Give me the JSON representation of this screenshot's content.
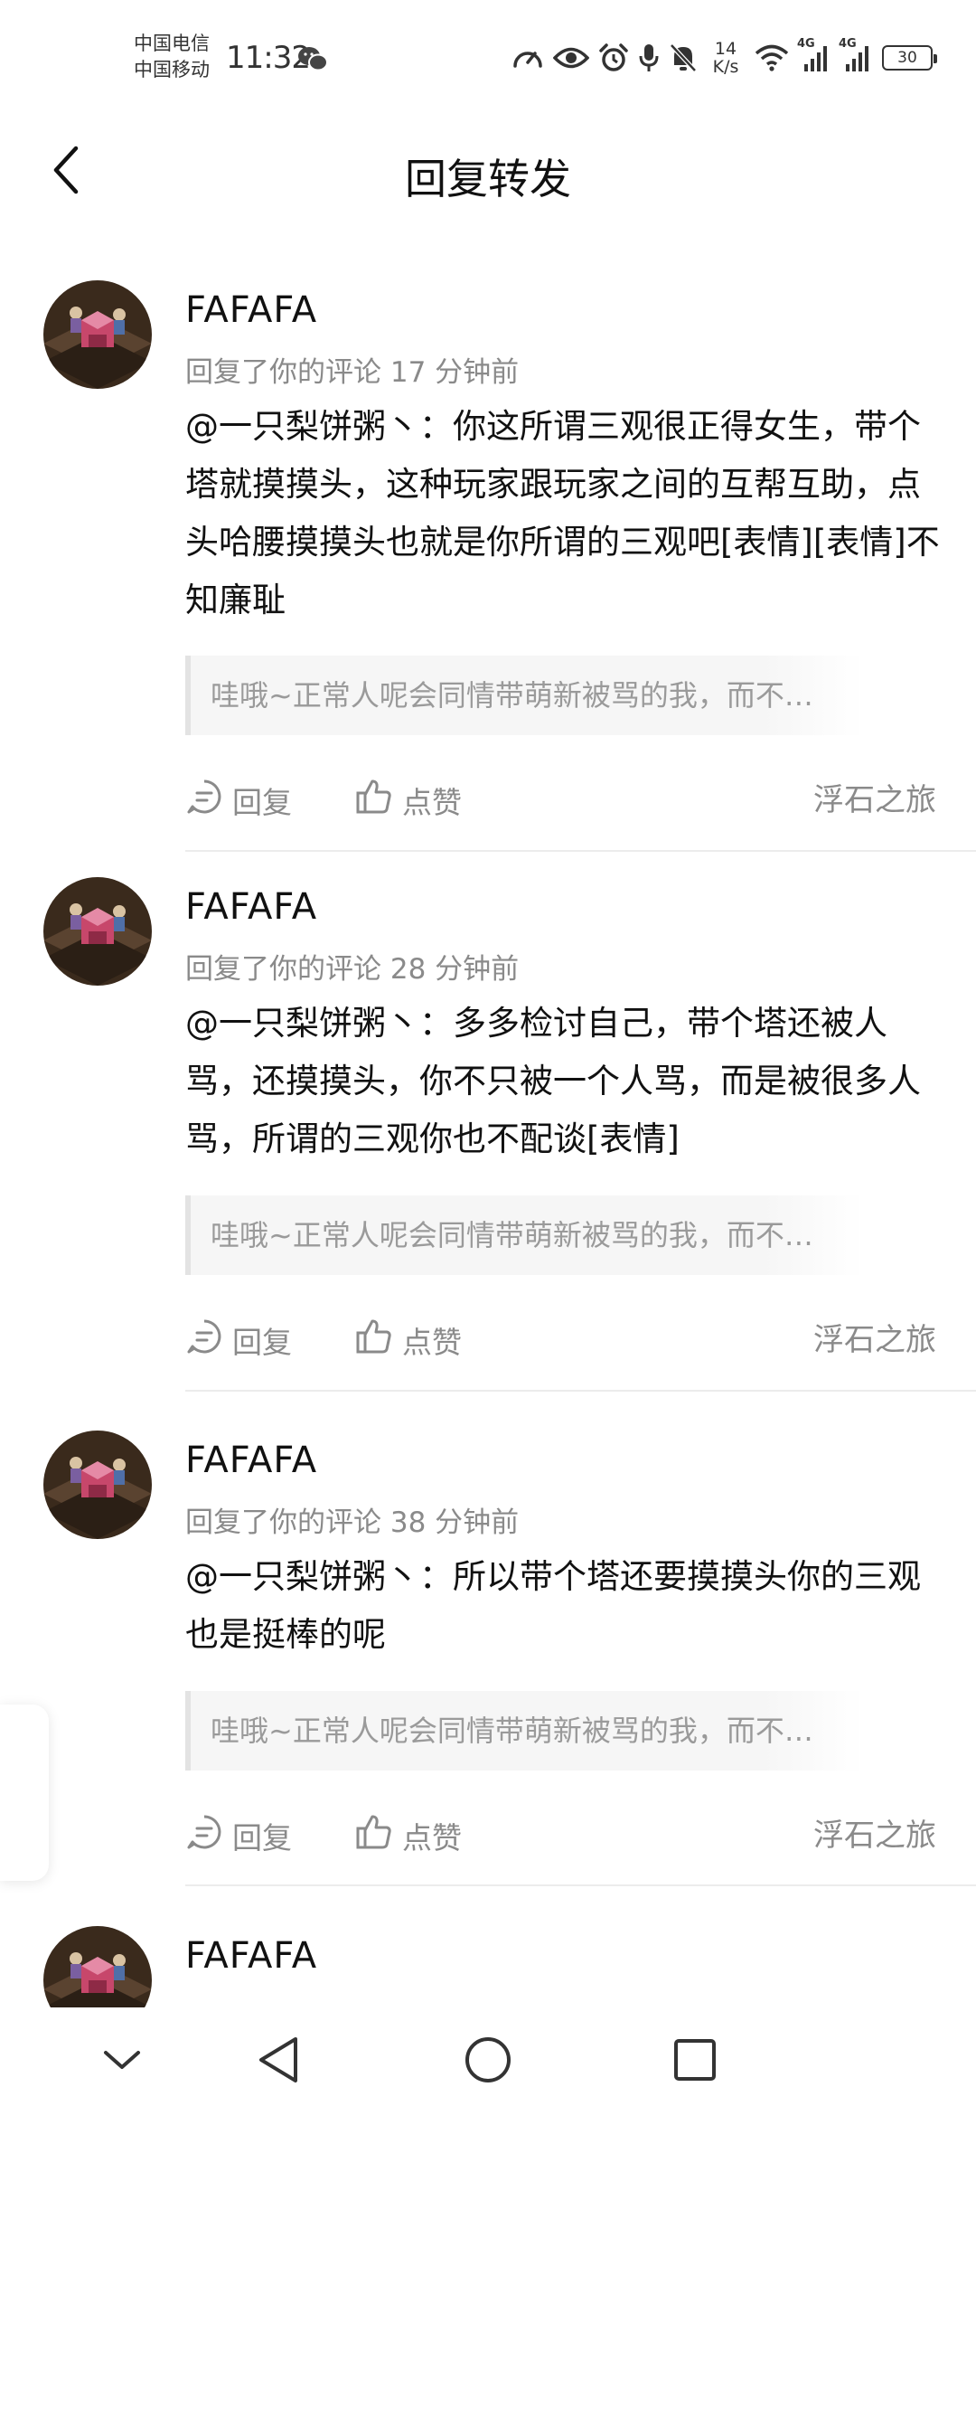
{
  "status_bar": {
    "carrier_1": "中国电信",
    "carrier_2": "中国移动",
    "time": "11:32",
    "speed_value": "14",
    "speed_unit": "K/s",
    "network_1": "4G",
    "network_2": "4G",
    "battery": "30",
    "icons": [
      "wechat-icon",
      "speedometer-icon",
      "eye-icon",
      "alarm-icon",
      "mic-icon",
      "mute-bell-icon",
      "wifi-icon",
      "signal-icon",
      "battery-icon"
    ]
  },
  "header": {
    "title": "回复转发",
    "back_icon": "chevron-left-icon"
  },
  "replies": [
    {
      "username": "FAFAFA",
      "meta": "回复了你的评论 17 分钟前",
      "content": "@一只梨饼粥丶：你这所谓三观很正得女生，带个塔就摸摸头，这种玩家跟玩家之间的互帮互助，点头哈腰摸摸头也就是你所谓的三观吧[表情][表情]不知廉耻",
      "quote": "哇哦~正常人呢会同情带萌新被骂的我，而不…",
      "reply_label": "回复",
      "like_label": "点赞",
      "source": "浮石之旅"
    },
    {
      "username": "FAFAFA",
      "meta": "回复了你的评论 28 分钟前",
      "content": "@一只梨饼粥丶：多多检讨自己，带个塔还被人骂，还摸摸头，你不只被一个人骂，而是被很多人骂，所谓的三观你也不配谈[表情]",
      "quote": "哇哦~正常人呢会同情带萌新被骂的我，而不…",
      "reply_label": "回复",
      "like_label": "点赞",
      "source": "浮石之旅"
    },
    {
      "username": "FAFAFA",
      "meta": "回复了你的评论 38 分钟前",
      "content": "@一只梨饼粥丶：所以带个塔还要摸摸头你的三观也是挺棒的呢",
      "quote": "哇哦~正常人呢会同情带萌新被骂的我，而不…",
      "reply_label": "回复",
      "like_label": "点赞",
      "source": "浮石之旅"
    },
    {
      "username": "FAFAFA"
    }
  ],
  "nav_bar": {
    "icons": [
      "chevron-down-icon",
      "back-triangle-icon",
      "home-circle-icon",
      "recents-square-icon"
    ]
  },
  "colors": {
    "background": "#ffffff",
    "text_primary": "#111111",
    "text_secondary": "#8a8a8a",
    "quote_bg": "#f6f6f6",
    "divider": "#ececec"
  }
}
